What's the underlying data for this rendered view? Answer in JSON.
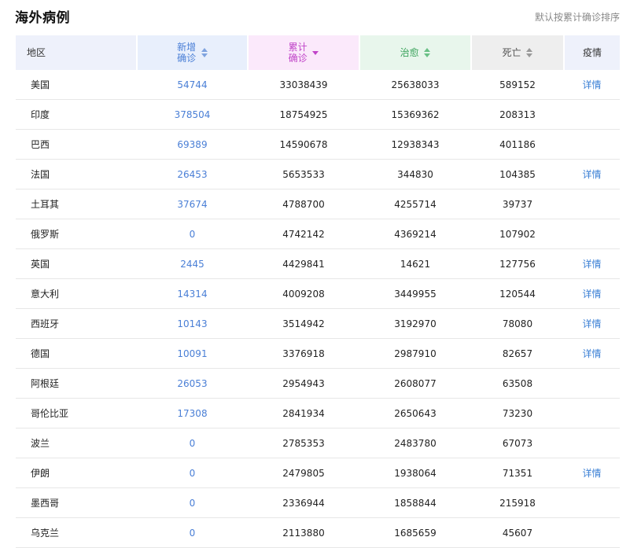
{
  "header": {
    "title": "海外病例",
    "sort_note": "默认按累计确诊排序"
  },
  "columns": {
    "region": "地区",
    "new_line1": "新增",
    "new_line2": "确诊",
    "total_line1": "累计",
    "total_line2": "确诊",
    "cured": "治愈",
    "dead": "死亡",
    "info": "疫情"
  },
  "colors": {
    "new_accent": "#4a7fd6",
    "total_accent": "#c044c8",
    "cured_accent": "#3aa35b",
    "link": "#3a7fd5"
  },
  "rows": [
    {
      "region": "美国",
      "new": "54744",
      "total": "33038439",
      "cured": "25638033",
      "dead": "589152",
      "detail": "详情"
    },
    {
      "region": "印度",
      "new": "378504",
      "total": "18754925",
      "cured": "15369362",
      "dead": "208313",
      "detail": ""
    },
    {
      "region": "巴西",
      "new": "69389",
      "total": "14590678",
      "cured": "12938343",
      "dead": "401186",
      "detail": ""
    },
    {
      "region": "法国",
      "new": "26453",
      "total": "5653533",
      "cured": "344830",
      "dead": "104385",
      "detail": "详情"
    },
    {
      "region": "土耳其",
      "new": "37674",
      "total": "4788700",
      "cured": "4255714",
      "dead": "39737",
      "detail": ""
    },
    {
      "region": "俄罗斯",
      "new": "0",
      "total": "4742142",
      "cured": "4369214",
      "dead": "107902",
      "detail": ""
    },
    {
      "region": "英国",
      "new": "2445",
      "total": "4429841",
      "cured": "14621",
      "dead": "127756",
      "detail": "详情"
    },
    {
      "region": "意大利",
      "new": "14314",
      "total": "4009208",
      "cured": "3449955",
      "dead": "120544",
      "detail": "详情"
    },
    {
      "region": "西班牙",
      "new": "10143",
      "total": "3514942",
      "cured": "3192970",
      "dead": "78080",
      "detail": "详情"
    },
    {
      "region": "德国",
      "new": "10091",
      "total": "3376918",
      "cured": "2987910",
      "dead": "82657",
      "detail": "详情"
    },
    {
      "region": "阿根廷",
      "new": "26053",
      "total": "2954943",
      "cured": "2608077",
      "dead": "63508",
      "detail": ""
    },
    {
      "region": "哥伦比亚",
      "new": "17308",
      "total": "2841934",
      "cured": "2650643",
      "dead": "73230",
      "detail": ""
    },
    {
      "region": "波兰",
      "new": "0",
      "total": "2785353",
      "cured": "2483780",
      "dead": "67073",
      "detail": ""
    },
    {
      "region": "伊朗",
      "new": "0",
      "total": "2479805",
      "cured": "1938064",
      "dead": "71351",
      "detail": "详情"
    },
    {
      "region": "墨西哥",
      "new": "0",
      "total": "2336944",
      "cured": "1858844",
      "dead": "215918",
      "detail": ""
    },
    {
      "region": "乌克兰",
      "new": "0",
      "total": "2113880",
      "cured": "1685659",
      "dead": "45607",
      "detail": ""
    }
  ]
}
